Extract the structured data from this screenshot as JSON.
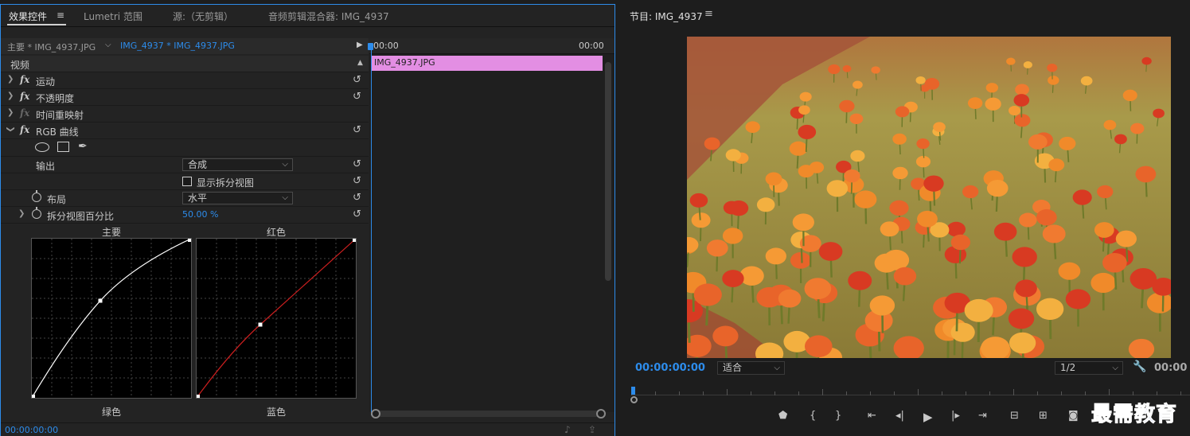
{
  "left_tabs": [
    {
      "label": "效果控件",
      "active": true
    },
    {
      "label": "Lumetri 范围",
      "active": false
    },
    {
      "label": "源:（无剪辑）",
      "active": false
    },
    {
      "label": "音频剪辑混合器: IMG_4937",
      "active": false
    }
  ],
  "menu_glyph": "≡",
  "ec_header": {
    "master": "主要 * IMG_4937.JPG",
    "clip": "IMG_4937 * IMG_4937.JPG",
    "arrow": "▶"
  },
  "timeline": {
    "start_tc": "00:00",
    "end_tc": "00:00",
    "clip_label": "IMG_4937.JPG"
  },
  "effects": {
    "video_label": "视频",
    "motion": "运动",
    "opacity": "不透明度",
    "time_remap": "时间重映射",
    "rgb_curves": "RGB 曲线",
    "output_label": "输出",
    "output_value": "合成",
    "split_view_label": "显示拆分视图",
    "layout_label": "布局",
    "layout_value": "水平",
    "split_percent_label": "拆分视图百分比",
    "split_percent_value": "50.00 %"
  },
  "curves": {
    "master": "主要",
    "red": "红色",
    "green": "绿色",
    "blue": "蓝色",
    "master_point": [
      0.43,
      0.61
    ],
    "red_point": [
      0.4,
      0.46
    ],
    "colors": {
      "master": "#ffffff",
      "red": "#cc1f1f"
    }
  },
  "footer": {
    "timecode": "00:00:00:00"
  },
  "program": {
    "tab": "节目: IMG_4937",
    "timecode": "00:00:00:00",
    "fit": "适合",
    "resolution": "1/2",
    "timecode_end": "00:00"
  },
  "transport_icons": [
    "marker-icon",
    "in-point-icon",
    "out-point-icon",
    "go-to-in-icon",
    "step-back-icon",
    "play-icon",
    "step-forward-icon",
    "go-to-out-icon",
    "lift-icon",
    "extract-icon",
    "camera-icon"
  ],
  "watermark": "最需教育",
  "colors": {
    "accent": "#2d8ceb",
    "clip": "#e38ee3"
  }
}
